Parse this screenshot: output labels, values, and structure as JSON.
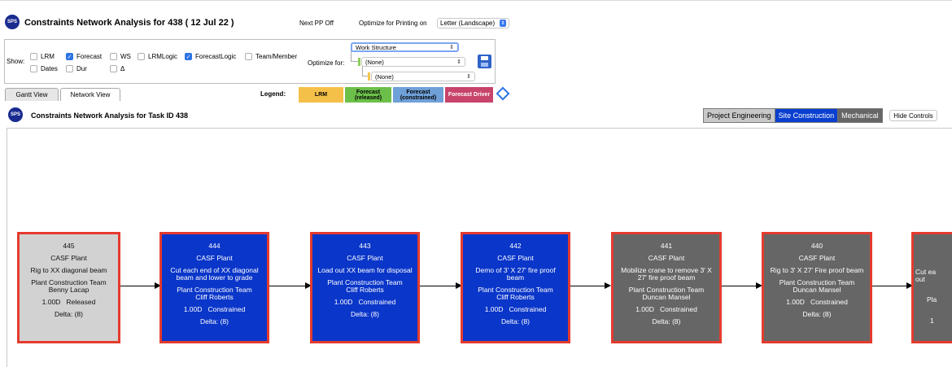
{
  "app": {
    "logo_text": "SPS",
    "title": "Constraints Network Analysis for 438 ( 12 Jul 22 )",
    "next_pp": "Next PP Off",
    "optimize_printing_label": "Optimize for Printing on",
    "optimize_printing_value": "Letter (Landscape)"
  },
  "controls": {
    "show_label": "Show:",
    "checkboxes": [
      {
        "label": "LRM",
        "checked": false
      },
      {
        "label": "Forecast",
        "checked": true
      },
      {
        "label": "WS",
        "checked": false
      },
      {
        "label": "LRMLogic",
        "checked": false
      },
      {
        "label": "ForecastLogic",
        "checked": true
      },
      {
        "label": "Team/Member",
        "checked": false
      },
      {
        "label": "Dates",
        "checked": false
      },
      {
        "label": "Dur",
        "checked": false
      },
      {
        "label": "Δ",
        "checked": false
      }
    ],
    "optimize_for_label": "Optimize for:",
    "selects": [
      "Work Structure",
      "(None)",
      "(None)"
    ]
  },
  "tabs": [
    {
      "label": "Gantt View",
      "active": false
    },
    {
      "label": "Network View",
      "active": true
    }
  ],
  "legend": {
    "label": "Legend:",
    "items": [
      {
        "label": "LRM",
        "color": "#f5c04a"
      },
      {
        "label": "Forecast\n(released)",
        "color": "#6cc04a"
      },
      {
        "label": "Forecast\n(constrained)",
        "color": "#6fa0d8"
      },
      {
        "label": "Forecast Driver",
        "color": "#c8446a"
      }
    ]
  },
  "subtitle": "Constraints Network Analysis for Task ID 438",
  "departments": [
    {
      "label": "Project Engineering",
      "style": "grey"
    },
    {
      "label": "Site Construction",
      "style": "blue"
    },
    {
      "label": "Mechanical",
      "style": "dark"
    }
  ],
  "hide_controls": "Hide Controls",
  "nodes": [
    {
      "id": "445",
      "plant": "CASF Plant",
      "desc": "Rig to XX diagonal beam",
      "team": "Plant Construction Team",
      "member": "Benny Lacap",
      "dur": "1.00D",
      "status": "Released",
      "delta": "Delta: (8)",
      "style": "released"
    },
    {
      "id": "444",
      "plant": "CASF Plant",
      "desc": "Cut each end of XX diagonal beam and lower to grade",
      "team": "Plant Construction Team",
      "member": "Cliff Roberts",
      "dur": "1.00D",
      "status": "Constrained",
      "delta": "Delta: (8)",
      "style": "constrained"
    },
    {
      "id": "443",
      "plant": "CASF Plant",
      "desc": "Load out XX beam for disposal",
      "team": "Plant Construction Team",
      "member": "Cliff Roberts",
      "dur": "1.00D",
      "status": "Constrained",
      "delta": "Delta: (8)",
      "style": "constrained"
    },
    {
      "id": "442",
      "plant": "CASF Plant",
      "desc": "Demo of 3' X 27' fire proof beam",
      "team": "Plant Construction Team",
      "member": "Cliff Roberts",
      "dur": "1.00D",
      "status": "Constrained",
      "delta": "Delta: (8)",
      "style": "constrained"
    },
    {
      "id": "441",
      "plant": "CASF Plant",
      "desc": "Mobilize crane to remove 3' X 27' fire proof beam",
      "team": "Plant Construction Team",
      "member": "Duncan Mansel",
      "dur": "1.00D",
      "status": "Constrained",
      "delta": "Delta: (8)",
      "style": "grey"
    },
    {
      "id": "440",
      "plant": "CASF Plant",
      "desc": "Rig to 3' X 27' Fire proof beam",
      "team": "Plant Construction Team",
      "member": "Duncan Mansel",
      "dur": "1.00D",
      "status": "Constrained",
      "delta": "Delta: (8)",
      "style": "grey"
    },
    {
      "id": "",
      "plant": "",
      "desc": "Cut ea out",
      "team": "Pla",
      "member": "",
      "dur": "1",
      "status": "",
      "delta": "",
      "style": "grey"
    }
  ]
}
